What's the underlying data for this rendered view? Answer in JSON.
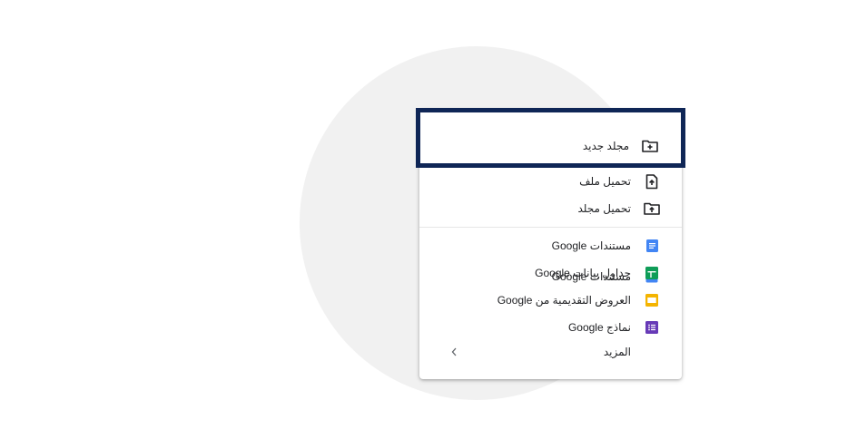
{
  "menu": {
    "new_folder": {
      "label": "مجلد جديد",
      "icon": "new-folder-icon"
    },
    "upload_file": {
      "label": "تحميل ملف",
      "icon": "upload-file-icon"
    },
    "upload_folder": {
      "label": "تحميل مجلد",
      "icon": "upload-folder-icon"
    },
    "google_docs": {
      "label": "مستندات Google",
      "icon": "docs-icon",
      "color": "#4285f4"
    },
    "google_sheets": {
      "label": "جداول بيانات Google",
      "icon": "sheets-icon",
      "color": "#0f9d58"
    },
    "google_slides": {
      "label": "العروض التقديمية من Google",
      "icon": "slides-icon",
      "color": "#f4b400"
    },
    "google_forms": {
      "label": "نماذج Google",
      "icon": "forms-icon",
      "color": "#673ab7"
    },
    "more": {
      "label": "المزيد",
      "icon": "chevron-left-icon"
    }
  },
  "colors": {
    "highlight_border": "#0f2656",
    "background_circle": "#f1f1f1"
  }
}
